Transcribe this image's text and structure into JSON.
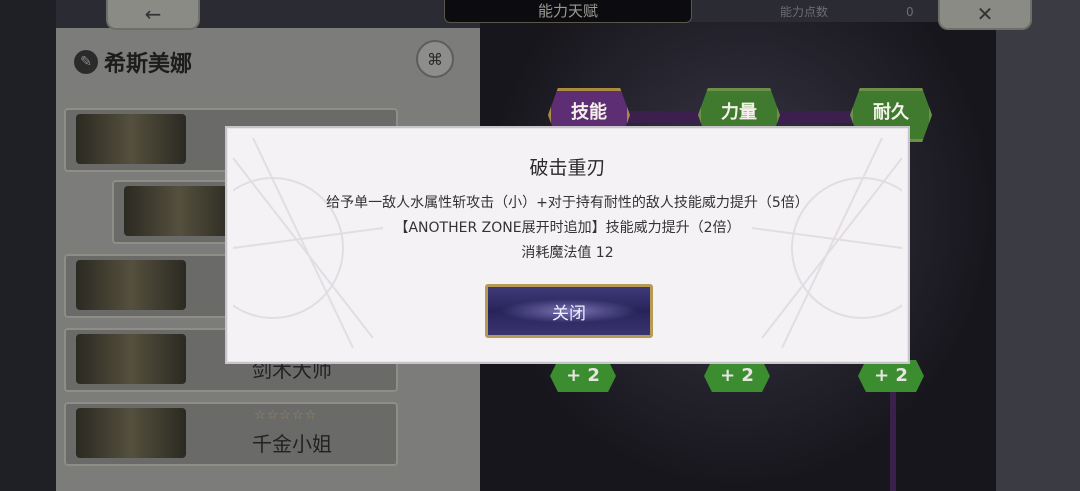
{
  "header": {
    "back_icon": "arrow-left-icon",
    "title": "能力天赋",
    "points_label": "能力点数",
    "points_value": "0",
    "close_icon": "close-icon"
  },
  "character": {
    "name": "希斯美娜",
    "emblem_icon": "emblem-icon",
    "swap_icon": "swap-icon"
  },
  "cards": [
    {
      "name": "",
      "stars": ""
    },
    {
      "name": "",
      "stars": ""
    },
    {
      "name": "",
      "stars": ""
    },
    {
      "name": "剑术大师",
      "stars": ""
    },
    {
      "name": "千金小姐",
      "stars": "☆☆☆☆☆"
    }
  ],
  "board": {
    "nodes": [
      {
        "label": "技能"
      },
      {
        "label": "力量"
      },
      {
        "label": "耐久"
      }
    ],
    "plus_nodes": [
      {
        "label": "+ 2"
      },
      {
        "label": "+ 2"
      },
      {
        "label": "+ 2"
      }
    ]
  },
  "modal": {
    "title": "破击重刃",
    "line1": "给予单一敌人水属性斩攻击（小）+对于持有耐性的敌人技能威力提升（5倍）",
    "line2": "【ANOTHER ZONE展开时追加】技能威力提升（2倍）",
    "line3": "消耗魔法值 12",
    "close_label": "关闭"
  },
  "colors": {
    "modal_bg": "#f4f2f5",
    "button_bg": "#2f2b65",
    "button_border": "#b79a55",
    "node_green": "#3f7a2e",
    "node_purple": "#5d2e74"
  }
}
